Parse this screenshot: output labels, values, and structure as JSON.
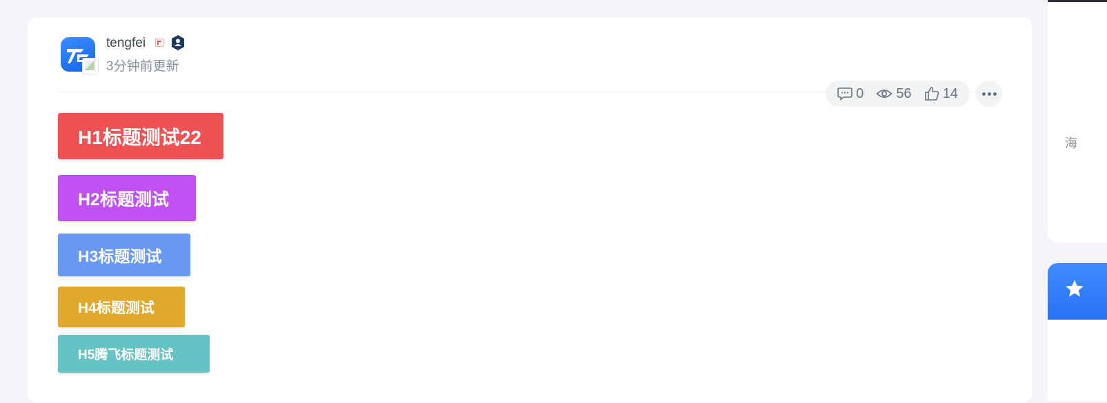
{
  "post": {
    "author": "tengfei",
    "update_time": "3分钟前更新",
    "stats": {
      "comments": "0",
      "views": "56",
      "likes": "14"
    }
  },
  "headings": [
    {
      "label": "H1标题测试22",
      "color": "#ef5254"
    },
    {
      "label": "H2标题测试",
      "color": "#bf51f1"
    },
    {
      "label": "H3标题测试",
      "color": "#6898f0"
    },
    {
      "label": "H4标题测试",
      "color": "#e1a92b"
    },
    {
      "label": "H5腾飞标题测试",
      "color": "#65c3c3"
    }
  ],
  "sidebar": {
    "text_fragment": "海"
  },
  "icons": {
    "avatar": "logo-avatar",
    "broken_image": "broken-image-icon",
    "flag": "flag-icon",
    "verified": "verified-user-icon",
    "comment": "comment-icon",
    "view": "eye-icon",
    "like": "thumbs-up-icon",
    "more": "more-icon",
    "star": "star-icon"
  }
}
